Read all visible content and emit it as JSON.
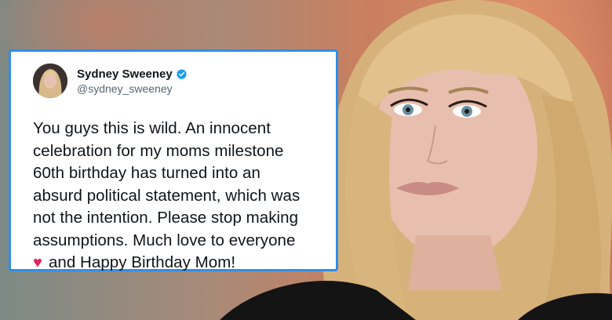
{
  "tweet": {
    "display_name": "Sydney Sweeney",
    "handle": "@sydney_sweeney",
    "verified": true,
    "body_lines": [
      "You guys this is wild. An innocent",
      "celebration for my moms milestone",
      "60th birthday has turned into an",
      "absurd political statement, which was",
      "not the intention. Please stop making",
      "assumptions. Much love to everyone"
    ],
    "last_line_text": "and Happy Birthday Mom!",
    "heart_glyph": "♥"
  },
  "colors": {
    "card_border": "#2f8ee8",
    "verified_badge": "#1d9bf0",
    "heart": "#e0245e"
  },
  "icons": [
    "verified-badge-icon",
    "heart-icon",
    "avatar"
  ]
}
